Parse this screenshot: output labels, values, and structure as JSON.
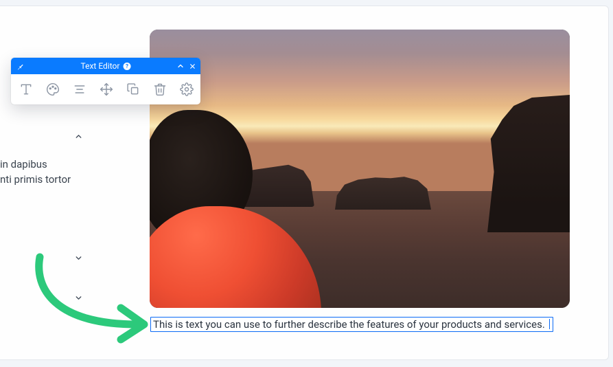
{
  "toolbar": {
    "title": "Text Editor",
    "buttons": {
      "format": "format",
      "color": "color",
      "align": "align",
      "move": "move",
      "duplicate": "duplicate",
      "delete": "delete",
      "settings": "settings"
    }
  },
  "accordion": {
    "line1": "in dapibus",
    "line2": "nti primis tortor"
  },
  "caption_text": "This is text you can use to further describe the features of your products and services."
}
